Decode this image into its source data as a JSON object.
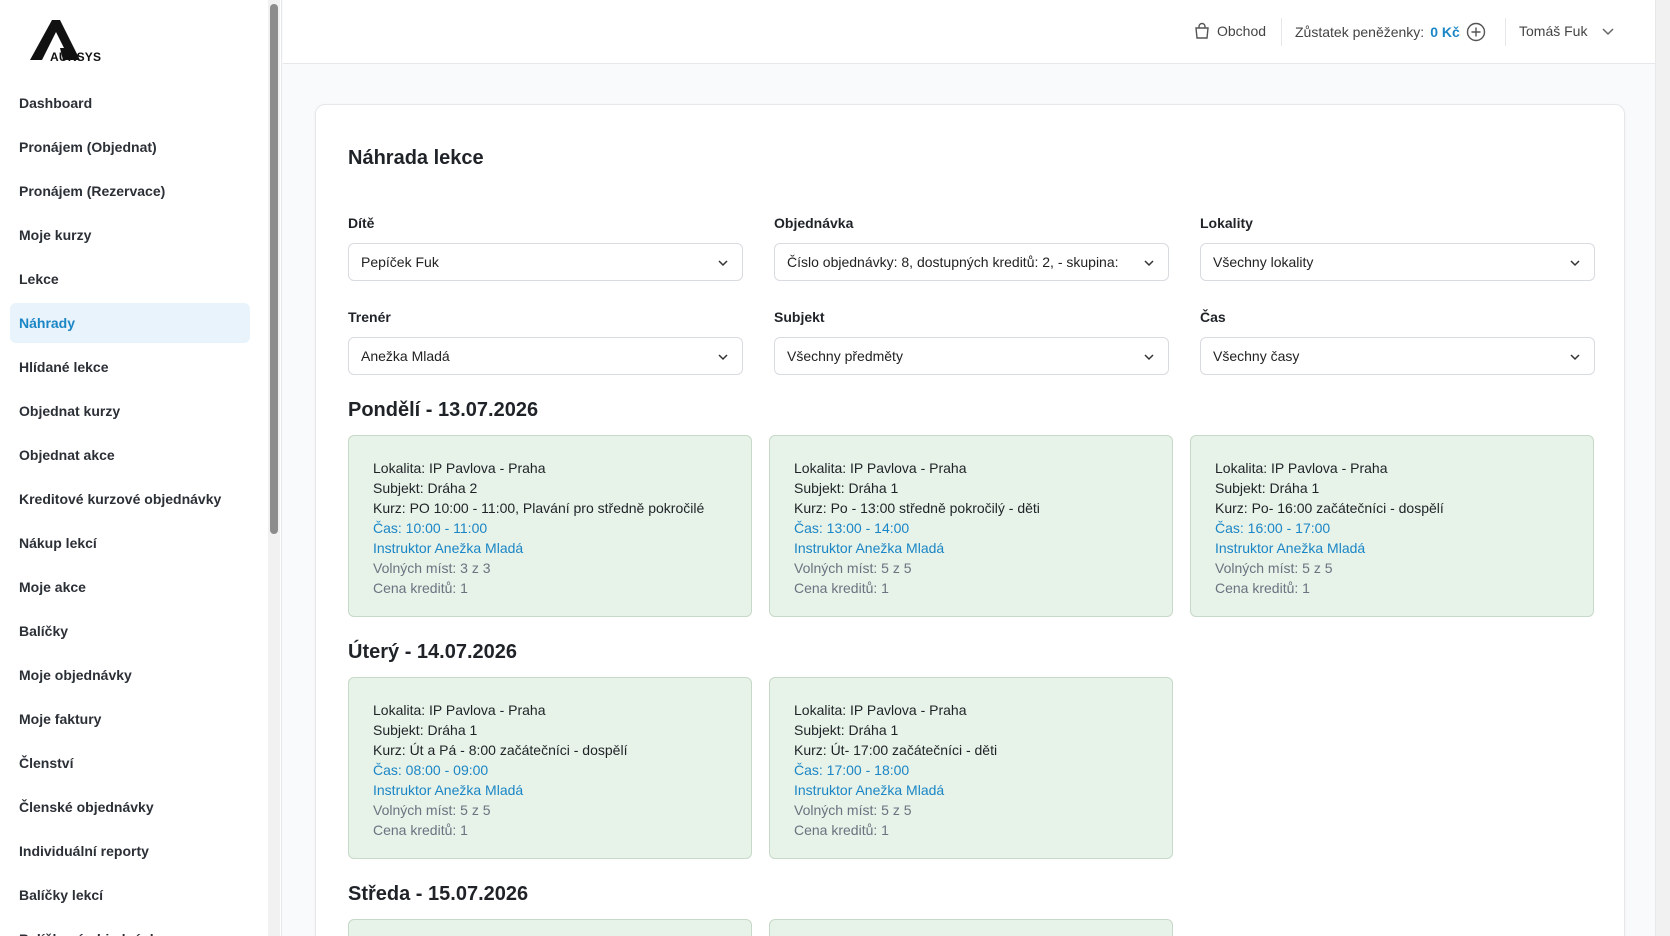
{
  "brand": {
    "logo_text": "AUKSYS"
  },
  "sidebar": {
    "items": [
      {
        "label": "Dashboard"
      },
      {
        "label": "Pronájem (Objednat)"
      },
      {
        "label": "Pronájem (Rezervace)"
      },
      {
        "label": "Moje kurzy"
      },
      {
        "label": "Lekce"
      },
      {
        "label": "Náhrady",
        "active": true
      },
      {
        "label": "Hlídané lekce"
      },
      {
        "label": "Objednat kurzy"
      },
      {
        "label": "Objednat akce"
      },
      {
        "label": "Kreditové kurzové objednávky"
      },
      {
        "label": "Nákup lekcí"
      },
      {
        "label": "Moje akce"
      },
      {
        "label": "Balíčky"
      },
      {
        "label": "Moje objednávky"
      },
      {
        "label": "Moje faktury"
      },
      {
        "label": "Členství"
      },
      {
        "label": "Členské objednávky"
      },
      {
        "label": "Individuální reporty"
      },
      {
        "label": "Balíčky lekcí"
      },
      {
        "label": "Balíčkové objednávky"
      }
    ]
  },
  "topbar": {
    "shop_label": "Obchod",
    "wallet_label": "Zůstatek peněženky:",
    "wallet_amount": "0 Kč",
    "user_name": "Tomáš Fuk"
  },
  "page": {
    "title": "Náhrada lekce",
    "filters": {
      "child": {
        "label": "Dítě",
        "value": "Pepíček Fuk"
      },
      "order": {
        "label": "Objednávka",
        "value": "Číslo objednávky: 8, dostupných kreditů: 2, - skupina:"
      },
      "location": {
        "label": "Lokality",
        "value": "Všechny lokality"
      },
      "trainer": {
        "label": "Trenér",
        "value": "Anežka Mladá"
      },
      "subject": {
        "label": "Subjekt",
        "value": "Všechny předměty"
      },
      "time": {
        "label": "Čas",
        "value": "Všechny časy"
      }
    },
    "days": [
      {
        "heading": "Pondělí - 13.07.2026",
        "lessons": [
          {
            "location": "Lokalita: IP Pavlova - Praha",
            "subject": "Subjekt: Dráha 2",
            "course": "Kurz: PO 10:00 - 11:00, Plavání pro středně pokročilé",
            "time": "Čas: 10:00 - 11:00",
            "instructor": "Instruktor Anežka Mladá",
            "free": "Volných míst: 3 z 3",
            "price": "Cena kreditů: 1"
          },
          {
            "location": "Lokalita: IP Pavlova - Praha",
            "subject": "Subjekt: Dráha 1",
            "course": "Kurz: Po - 13:00 středně pokročilý - děti",
            "time": "Čas: 13:00 - 14:00",
            "instructor": "Instruktor Anežka Mladá",
            "free": "Volných míst: 5 z 5",
            "price": "Cena kreditů: 1"
          },
          {
            "location": "Lokalita: IP Pavlova - Praha",
            "subject": "Subjekt: Dráha 1",
            "course": "Kurz: Po- 16:00 začátečníci - dospělí",
            "time": "Čas: 16:00 - 17:00",
            "instructor": "Instruktor Anežka Mladá",
            "free": "Volných míst: 5 z 5",
            "price": "Cena kreditů: 1"
          }
        ]
      },
      {
        "heading": "Úterý - 14.07.2026",
        "lessons": [
          {
            "location": "Lokalita: IP Pavlova - Praha",
            "subject": "Subjekt: Dráha 1",
            "course": "Kurz: Út a Pá - 8:00 začátečníci - dospělí",
            "time": "Čas: 08:00 - 09:00",
            "instructor": "Instruktor Anežka Mladá",
            "free": "Volných míst: 5 z 5",
            "price": "Cena kreditů: 1"
          },
          {
            "location": "Lokalita: IP Pavlova - Praha",
            "subject": "Subjekt: Dráha 1",
            "course": "Kurz: Út- 17:00 začátečníci - děti",
            "time": "Čas: 17:00 - 18:00",
            "instructor": "Instruktor Anežka Mladá",
            "free": "Volných míst: 5 z 5",
            "price": "Cena kreditů: 1"
          }
        ]
      },
      {
        "heading": "Středa - 15.07.2026",
        "lessons": []
      }
    ]
  },
  "colors": {
    "accent": "#1b86c6",
    "active_bg": "#e8f3fb",
    "lesson_bg": "#e7f2e8",
    "lesson_border": "#c7d9c8"
  },
  "icons": {
    "shop": "shopping-bag-icon",
    "wallet_add": "plus-circle-icon",
    "user_menu": "chevron-down-icon",
    "select": "chevron-down-icon"
  }
}
